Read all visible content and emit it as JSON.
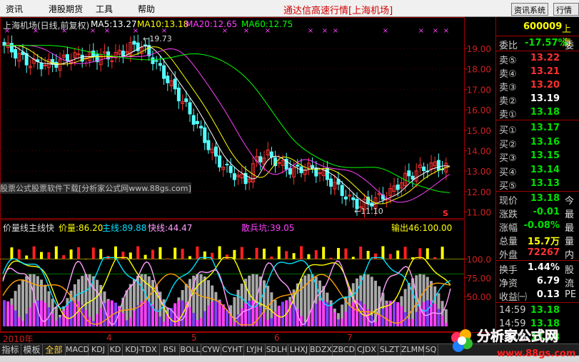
{
  "menu": [
    "资讯",
    "港股期货",
    "工具",
    "帮助"
  ],
  "center_title": "通达信高速行情[上海机场]",
  "sys_buttons": [
    "资讯系统",
    "行情软件"
  ],
  "main": {
    "stock_label": "上海机场(日线,前复权)",
    "ma5": "MA5:13.27",
    "ma10": "MA10:13.18",
    "ma20": "MA20:12.65",
    "ma60": "MA60:12.75",
    "high_annot": "19.73",
    "low_annot": "11.10",
    "s_marker": "S",
    "price_ticks": [
      "19.00",
      "18.00",
      "17.00",
      "16.00",
      "15.00",
      "14.00",
      "13.00",
      "12.00",
      "11.00"
    ],
    "colors": {
      "ma5": "#ffffff",
      "ma10": "#ffff00",
      "ma20": "#ff40ff",
      "ma60": "#00ff00",
      "up": "#ff3030",
      "down": "#54ffff"
    }
  },
  "indicator": {
    "title": "价量线主线快",
    "jl": "价量:86.20",
    "zx": "主线:89.88",
    "kx": "快线:44.47",
    "sbk": "散兵坑:39.05",
    "sc": "输出46:100.00",
    "ticks": [
      "100.0",
      "75.00",
      "50.00"
    ]
  },
  "watermark": "股票公式股票软件下载[分析家公式网www.88gs.com]",
  "timeline": [
    "2010年",
    "4",
    "5",
    "6",
    "7"
  ],
  "quote": {
    "code": "600009",
    "name": "上海",
    "webi_label": "委比",
    "webi": "-17.57%",
    "webi2": "委",
    "sells": [
      {
        "label": "卖⑤",
        "price": "13.22"
      },
      {
        "label": "卖④",
        "price": "13.21"
      },
      {
        "label": "卖③",
        "price": "13.20"
      },
      {
        "label": "卖②",
        "price": "13.19"
      },
      {
        "label": "卖①",
        "price": "13.18"
      }
    ],
    "buys": [
      {
        "label": "买①",
        "price": "13.17"
      },
      {
        "label": "买②",
        "price": "13.16"
      },
      {
        "label": "买③",
        "price": "13.15"
      },
      {
        "label": "买④",
        "price": "13.14"
      },
      {
        "label": "买⑤",
        "price": "13.13"
      }
    ],
    "stats": [
      {
        "label": "现价",
        "value": "13.18",
        "extra": "今"
      },
      {
        "label": "涨跌",
        "value": "-0.01",
        "extra": "最"
      },
      {
        "label": "涨幅",
        "value": "-0.08%",
        "extra": "最"
      },
      {
        "label": "总量",
        "value": "15.7万",
        "extra": "量"
      },
      {
        "label": "外盘",
        "value": "72267",
        "extra": "内"
      }
    ],
    "stats2": [
      {
        "label": "换手",
        "value": "1.44%",
        "extra": "股"
      },
      {
        "label": "净资",
        "value": "6.79",
        "extra": "流"
      },
      {
        "label": "收益㈠",
        "value": "0.13",
        "extra": "PE"
      }
    ],
    "ticks": [
      {
        "time": "14:59",
        "price": "13.18"
      },
      {
        "time": "14:59",
        "price": "13.18"
      },
      {
        "time": "15:00",
        "price": "13.18"
      }
    ]
  },
  "tabs": [
    "指标",
    "模板",
    "全部",
    "MACD",
    "KDJ",
    "KD",
    "KDJ-TDX",
    "RSI",
    "BOLL",
    "CYW",
    "CYHT",
    "LYJH",
    "SDLH",
    "LHXJ",
    "BDZX",
    "ZBCD",
    "CJDX",
    "SLZT",
    "ZLMM",
    "SQ"
  ],
  "logo": {
    "text": "分析家公式网",
    "url": "www.88gs.com"
  }
}
